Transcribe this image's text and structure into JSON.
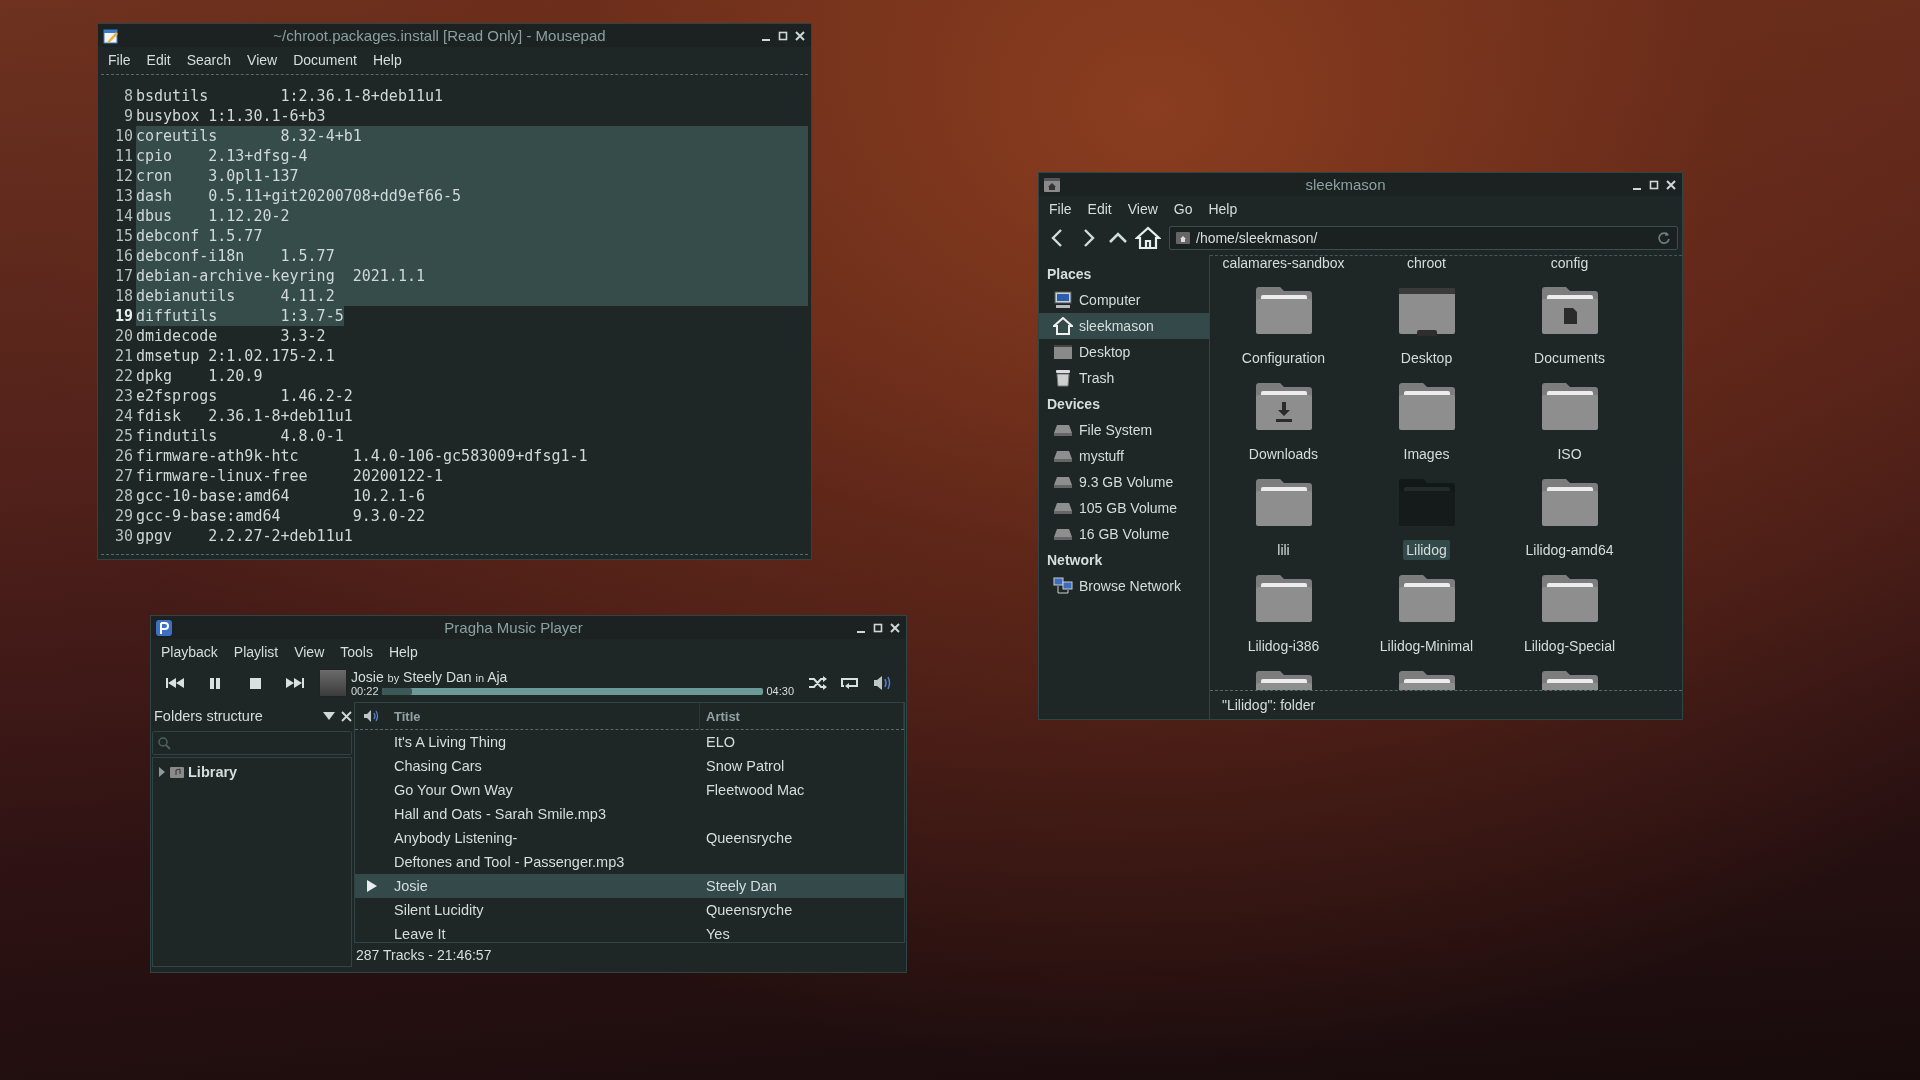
{
  "editor": {
    "title": "~/chroot.packages.install [Read Only] - Mousepad",
    "menu": [
      "File",
      "Edit",
      "Search",
      "View",
      "Document",
      "Help"
    ],
    "lines": [
      {
        "number": "8",
        "text": "bsdutils\t1:2.36.1-8+deb11u1",
        "selected": false,
        "current": false
      },
      {
        "number": "9",
        "text": "busybox 1:1.30.1-6+b3",
        "selected": false,
        "current": false
      },
      {
        "number": "10",
        "text": "coreutils\t8.32-4+b1",
        "selected": true,
        "current": false
      },
      {
        "number": "11",
        "text": "cpio\t2.13+dfsg-4",
        "selected": true,
        "current": false
      },
      {
        "number": "12",
        "text": "cron\t3.0pl1-137",
        "selected": true,
        "current": false
      },
      {
        "number": "13",
        "text": "dash\t0.5.11+git20200708+dd9ef66-5",
        "selected": true,
        "current": false
      },
      {
        "number": "14",
        "text": "dbus\t1.12.20-2",
        "selected": true,
        "current": false
      },
      {
        "number": "15",
        "text": "debconf 1.5.77",
        "selected": true,
        "current": false
      },
      {
        "number": "16",
        "text": "debconf-i18n\t1.5.77",
        "selected": true,
        "current": false
      },
      {
        "number": "17",
        "text": "debian-archive-keyring\t2021.1.1",
        "selected": true,
        "current": false
      },
      {
        "number": "18",
        "text": "debianutils\t4.11.2",
        "selected": true,
        "current": false
      },
      {
        "number": "19",
        "text": "diffutils\t1:3.7-5",
        "selected": true,
        "current": true
      },
      {
        "number": "20",
        "text": "dmidecode\t3.3-2",
        "selected": false,
        "current": false
      },
      {
        "number": "21",
        "text": "dmsetup 2:1.02.175-2.1",
        "selected": false,
        "current": false
      },
      {
        "number": "22",
        "text": "dpkg\t1.20.9",
        "selected": false,
        "current": false
      },
      {
        "number": "23",
        "text": "e2fsprogs\t1.46.2-2",
        "selected": false,
        "current": false
      },
      {
        "number": "24",
        "text": "fdisk\t2.36.1-8+deb11u1",
        "selected": false,
        "current": false
      },
      {
        "number": "25",
        "text": "findutils\t4.8.0-1",
        "selected": false,
        "current": false
      },
      {
        "number": "26",
        "text": "firmware-ath9k-htc\t1.4.0-106-gc583009+dfsg1-1",
        "selected": false,
        "current": false
      },
      {
        "number": "27",
        "text": "firmware-linux-free\t20200122-1",
        "selected": false,
        "current": false
      },
      {
        "number": "28",
        "text": "gcc-10-base:amd64\t10.2.1-6",
        "selected": false,
        "current": false
      },
      {
        "number": "29",
        "text": "gcc-9-base:amd64\t9.3.0-22",
        "selected": false,
        "current": false
      },
      {
        "number": "30",
        "text": "gpgv\t2.2.27-2+deb11u1",
        "selected": false,
        "current": false
      }
    ]
  },
  "file_manager": {
    "title": "sleekmason",
    "menu": [
      "File",
      "Edit",
      "View",
      "Go",
      "Help"
    ],
    "location": "/home/sleekmason/",
    "sidebar": [
      {
        "heading": "Places",
        "items": [
          {
            "label": "Computer",
            "kind": "computer",
            "selected": false
          },
          {
            "label": "sleekmason",
            "kind": "home",
            "selected": true
          },
          {
            "label": "Desktop",
            "kind": "desktop",
            "selected": false
          },
          {
            "label": "Trash",
            "kind": "trash",
            "selected": false
          }
        ]
      },
      {
        "heading": "Devices",
        "items": [
          {
            "label": "File System",
            "kind": "drive",
            "selected": false
          },
          {
            "label": "mystuff",
            "kind": "drive",
            "selected": false
          },
          {
            "label": "9.3 GB Volume",
            "kind": "drive",
            "selected": false
          },
          {
            "label": "105 GB Volume",
            "kind": "drive",
            "selected": false
          },
          {
            "label": "16 GB Volume",
            "kind": "drive",
            "selected": false
          }
        ]
      },
      {
        "heading": "Network",
        "items": [
          {
            "label": "Browse Network",
            "kind": "network",
            "selected": false
          }
        ]
      }
    ],
    "scrolled_labels": [
      "calamares-sandbox",
      "chroot",
      "config"
    ],
    "items": [
      {
        "label": "Configuration",
        "kind": "folder",
        "selected": false
      },
      {
        "label": "Desktop",
        "kind": "desktop",
        "selected": false
      },
      {
        "label": "Documents",
        "kind": "documents",
        "selected": false
      },
      {
        "label": "Downloads",
        "kind": "downloads",
        "selected": false
      },
      {
        "label": "Images",
        "kind": "folder",
        "selected": false
      },
      {
        "label": "ISO",
        "kind": "folder",
        "selected": false
      },
      {
        "label": "lili",
        "kind": "folder",
        "selected": false
      },
      {
        "label": "Lilidog",
        "kind": "folder",
        "selected": true
      },
      {
        "label": "Lilidog-amd64",
        "kind": "folder",
        "selected": false
      },
      {
        "label": "Lilidog-i386",
        "kind": "folder",
        "selected": false
      },
      {
        "label": "Lilidog-Minimal",
        "kind": "folder",
        "selected": false
      },
      {
        "label": "Lilidog-Special",
        "kind": "folder",
        "selected": false
      }
    ],
    "status": "\"Lilidog\": folder"
  },
  "music_player": {
    "title": "Pragha Music Player",
    "menu": [
      "Playback",
      "Playlist",
      "View",
      "Tools",
      "Help"
    ],
    "now_playing": {
      "track": "Josie",
      "by": "by",
      "artist": "Steely Dan",
      "in": "in",
      "album": "Aja",
      "elapsed": "00:22",
      "total": "04:30",
      "level": 0.08
    },
    "pane_title": "Folders structure",
    "tree": [
      {
        "label": "Library",
        "expanded": false
      }
    ],
    "columns": [
      "Title",
      "Artist"
    ],
    "rows": [
      {
        "title": "It's A Living Thing",
        "artist": "ELO",
        "selected": false,
        "playing": false
      },
      {
        "title": "Chasing Cars",
        "artist": "Snow Patrol",
        "selected": false,
        "playing": false
      },
      {
        "title": "Go Your Own Way",
        "artist": "Fleetwood Mac",
        "selected": false,
        "playing": false
      },
      {
        "title": "Hall and Oats - Sarah Smile.mp3",
        "selected": false,
        "playing": false
      },
      {
        "title": "Anybody Listening-",
        "artist": "Queensryche",
        "selected": false,
        "playing": false
      },
      {
        "title": "Deftones and Tool - Passenger.mp3",
        "selected": false,
        "playing": false
      },
      {
        "title": "Josie",
        "artist": "Steely Dan",
        "selected": true,
        "playing": true
      },
      {
        "title": "Silent Lucidity",
        "artist": "Queensryche",
        "selected": false,
        "playing": false
      },
      {
        "title": "Leave It",
        "artist": "Yes",
        "selected": false,
        "playing": false
      }
    ],
    "status": "287 Tracks - 21:46:57"
  }
}
